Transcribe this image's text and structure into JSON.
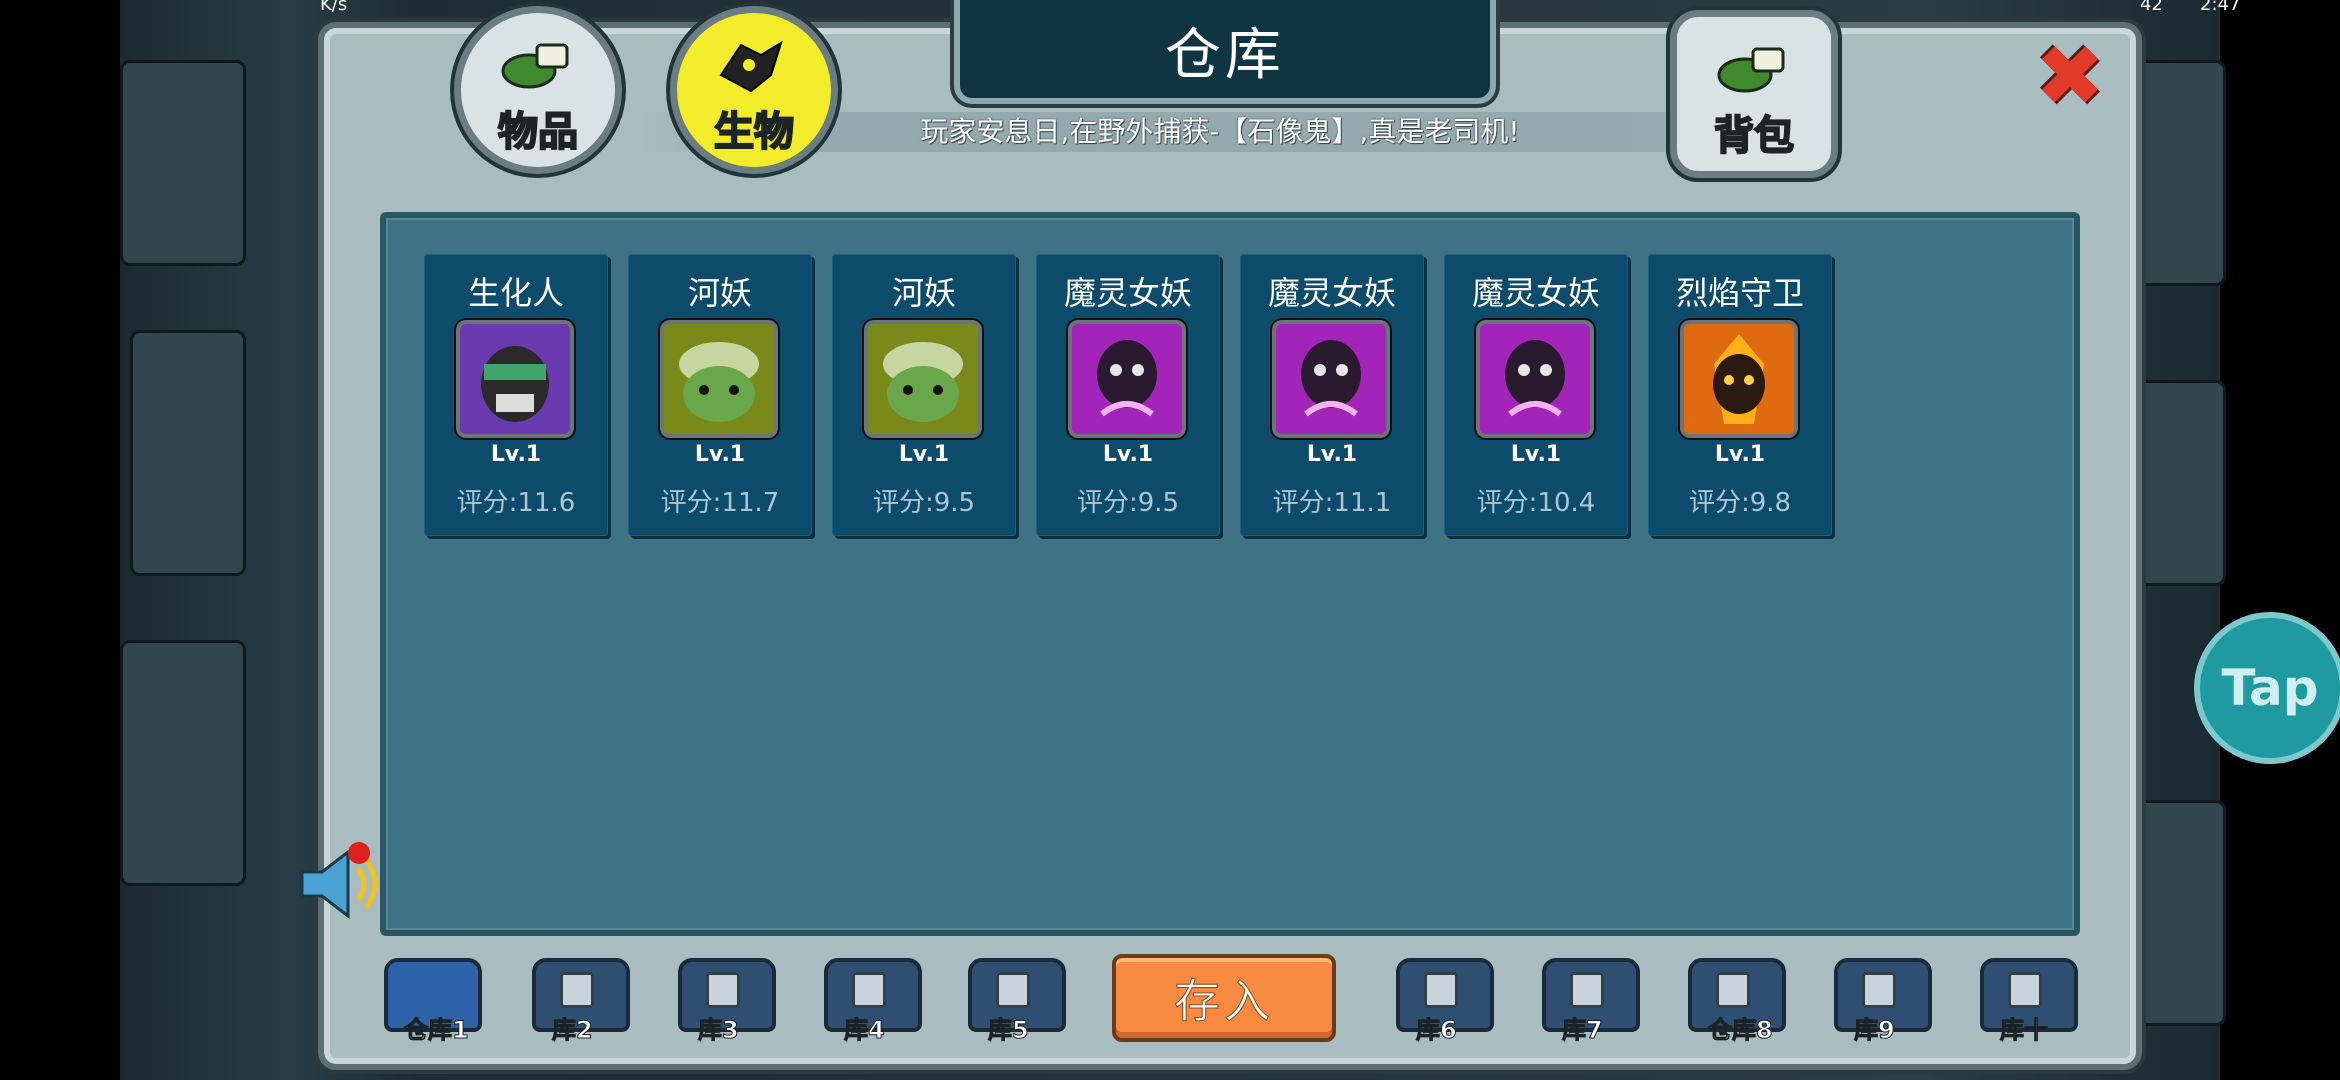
{
  "status_bar": {
    "speed": "K/s",
    "time": "2:47",
    "battery": "42"
  },
  "panel": {
    "title": "仓库",
    "marquee": "玩家安息日,在野外捕获-【石像鬼】,真是老司机!",
    "tabs_top": [
      {
        "label": "物品",
        "color": "#d9e2e4"
      },
      {
        "label": "生物",
        "color": "#f3ec2a"
      },
      {
        "label": "背包",
        "color": "#d9e2e4"
      }
    ]
  },
  "creatures": [
    {
      "name": "生化人",
      "level": "Lv.1",
      "score": "评分:11.6",
      "portrait": "cyborg",
      "bg": "#6a3bb0"
    },
    {
      "name": "河妖",
      "level": "Lv.1",
      "score": "评分:11.7",
      "portrait": "turtle",
      "bg": "#7a8a1a"
    },
    {
      "name": "河妖",
      "level": "Lv.1",
      "score": "评分:9.5",
      "portrait": "turtle",
      "bg": "#7a8a1a"
    },
    {
      "name": "魔灵女妖",
      "level": "Lv.1",
      "score": "评分:9.5",
      "portrait": "banshee",
      "bg": "#a224b8"
    },
    {
      "name": "魔灵女妖",
      "level": "Lv.1",
      "score": "评分:11.1",
      "portrait": "banshee",
      "bg": "#a224b8"
    },
    {
      "name": "魔灵女妖",
      "level": "Lv.1",
      "score": "评分:10.4",
      "portrait": "banshee",
      "bg": "#a224b8"
    },
    {
      "name": "烈焰守卫",
      "level": "Lv.1",
      "score": "评分:9.8",
      "portrait": "flame",
      "bg": "#e06a10"
    }
  ],
  "bottom": {
    "deposit": "存入",
    "warehouses": [
      {
        "label": "仓库1",
        "active": true
      },
      {
        "label": "库2",
        "active": false
      },
      {
        "label": "库3",
        "active": false
      },
      {
        "label": "库4",
        "active": false
      },
      {
        "label": "库5",
        "active": false
      },
      {
        "label": "库6",
        "active": false
      },
      {
        "label": "库7",
        "active": false
      },
      {
        "label": "仓库8",
        "active": false
      },
      {
        "label": "库9",
        "active": false
      },
      {
        "label": "库十",
        "active": false
      }
    ]
  },
  "overlay": {
    "tap": "Tap"
  },
  "colors": {
    "accent": "#f58a40",
    "card": "#0d4b6a",
    "storage": "#3f7284",
    "close": "#e23a28"
  }
}
